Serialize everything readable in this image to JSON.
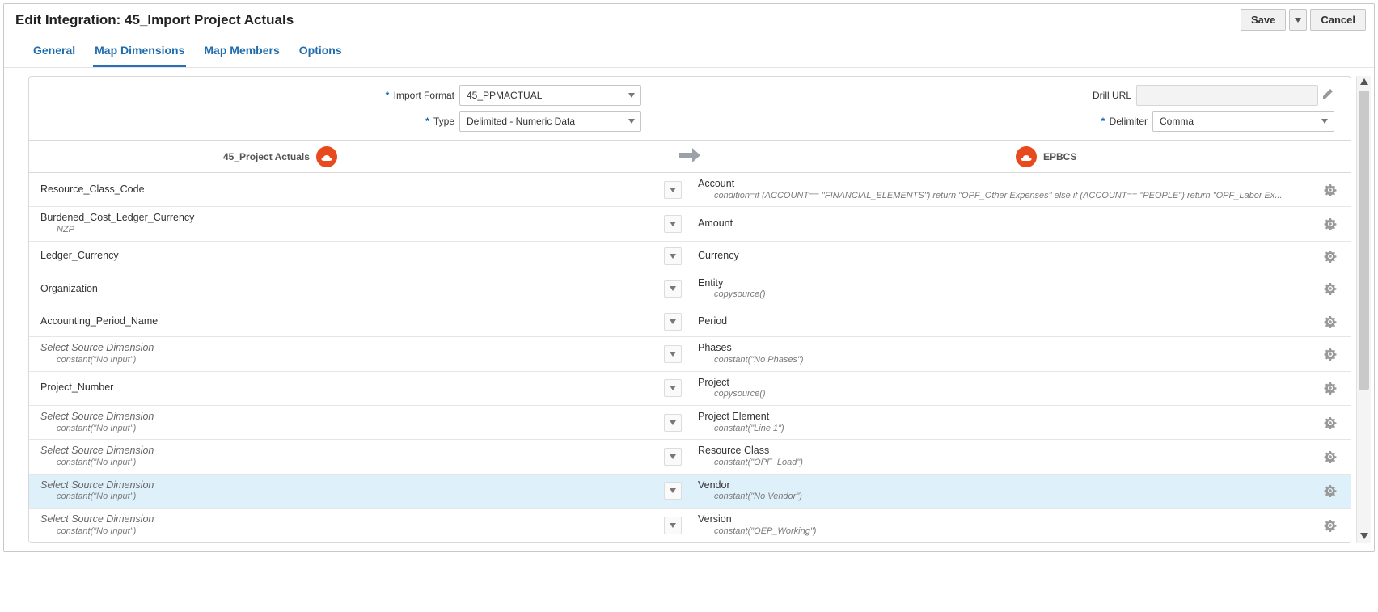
{
  "title_prefix": "Edit Integration: ",
  "title_name": "45_Import Project Actuals",
  "actions": {
    "save": "Save",
    "cancel": "Cancel"
  },
  "tabs": [
    "General",
    "Map Dimensions",
    "Map Members",
    "Options"
  ],
  "active_tab": 1,
  "form": {
    "import_format_label": "Import Format",
    "import_format_value": "45_PPMACTUAL",
    "type_label": "Type",
    "type_value": "Delimited - Numeric Data",
    "drill_url_label": "Drill URL",
    "drill_url_value": "",
    "delimiter_label": "Delimiter",
    "delimiter_value": "Comma"
  },
  "map_header": {
    "source": "45_Project Actuals",
    "target": "EPBCS"
  },
  "rows": [
    {
      "src": "Resource_Class_Code",
      "src_sub": "",
      "placeholder": false,
      "tgt": "Account",
      "tgt_sub": "condition=if (ACCOUNT== \"FINANCIAL_ELEMENTS\") return \"OPF_Other Expenses\" else if (ACCOUNT== \"PEOPLE\") return \"OPF_Labor Ex...",
      "selected": false
    },
    {
      "src": "Burdened_Cost_Ledger_Currency",
      "src_sub": "NZP",
      "placeholder": false,
      "tgt": "Amount",
      "tgt_sub": "",
      "selected": false
    },
    {
      "src": "Ledger_Currency",
      "src_sub": "",
      "placeholder": false,
      "tgt": "Currency",
      "tgt_sub": "",
      "selected": false
    },
    {
      "src": "Organization",
      "src_sub": "",
      "placeholder": false,
      "tgt": "Entity",
      "tgt_sub": "copysource()",
      "selected": false
    },
    {
      "src": "Accounting_Period_Name",
      "src_sub": "",
      "placeholder": false,
      "tgt": "Period",
      "tgt_sub": "",
      "selected": false
    },
    {
      "src": "Select Source Dimension",
      "src_sub": "constant(\"No Input\")",
      "placeholder": true,
      "tgt": "Phases",
      "tgt_sub": "constant(\"No Phases\")",
      "selected": false
    },
    {
      "src": "Project_Number",
      "src_sub": "",
      "placeholder": false,
      "tgt": "Project",
      "tgt_sub": "copysource()",
      "selected": false
    },
    {
      "src": "Select Source Dimension",
      "src_sub": "constant(\"No Input\")",
      "placeholder": true,
      "tgt": "Project Element",
      "tgt_sub": "constant(\"Line 1\")",
      "selected": false
    },
    {
      "src": "Select Source Dimension",
      "src_sub": "constant(\"No Input\")",
      "placeholder": true,
      "tgt": "Resource Class",
      "tgt_sub": "constant(\"OPF_Load\")",
      "selected": false
    },
    {
      "src": "Select Source Dimension",
      "src_sub": "constant(\"No Input\")",
      "placeholder": true,
      "tgt": "Vendor",
      "tgt_sub": "constant(\"No Vendor\")",
      "selected": true
    },
    {
      "src": "Select Source Dimension",
      "src_sub": "constant(\"No Input\")",
      "placeholder": true,
      "tgt": "Version",
      "tgt_sub": "constant(\"OEP_Working\")",
      "selected": false
    }
  ]
}
